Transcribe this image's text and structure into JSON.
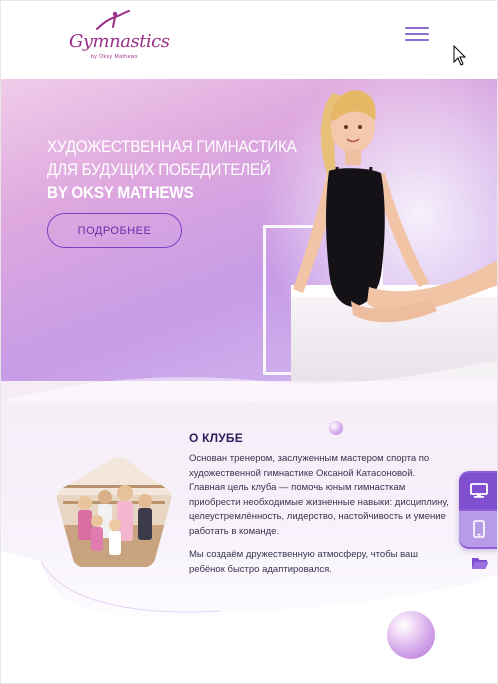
{
  "header": {
    "logo_text": "Gymnastics",
    "logo_sub": "by Oksy Mathews",
    "menu_icon": "hamburger-menu-icon"
  },
  "hero": {
    "title_line1": "ХУДОЖЕСТВЕННАЯ ГИМНАСТИКА",
    "title_line2": "ДЛЯ БУДУЩИХ ПОБЕДИТЕЛЕЙ",
    "title_line3": "BY OKSY MATHEWS",
    "button_label": "ПОДРОБНЕЕ"
  },
  "about": {
    "title": "О КЛУБЕ",
    "paragraph1": "Основан тренером, заслуженным мастером спорта по художественной гимнастике Оксаной Катасоновой. Главная цель клуба — помочь юным гимнасткам приобрести необходимые жизненные навыки: дисциплину, целеустремлённость, лидерство, настойчивость и умение работать в команде.",
    "paragraph2": "Мы создаём дружественную атмосферу, чтобы ваш ребёнок быстро адаптировался."
  },
  "side_panel": {
    "desktop_icon": "monitor-icon",
    "mobile_icon": "smartphone-icon",
    "folder_icon": "folder-open-icon"
  },
  "colors": {
    "accent": "#8c5fd6",
    "brand": "#9b2f86",
    "button_border": "#7d3fbf",
    "heading": "#2c1f5a"
  }
}
